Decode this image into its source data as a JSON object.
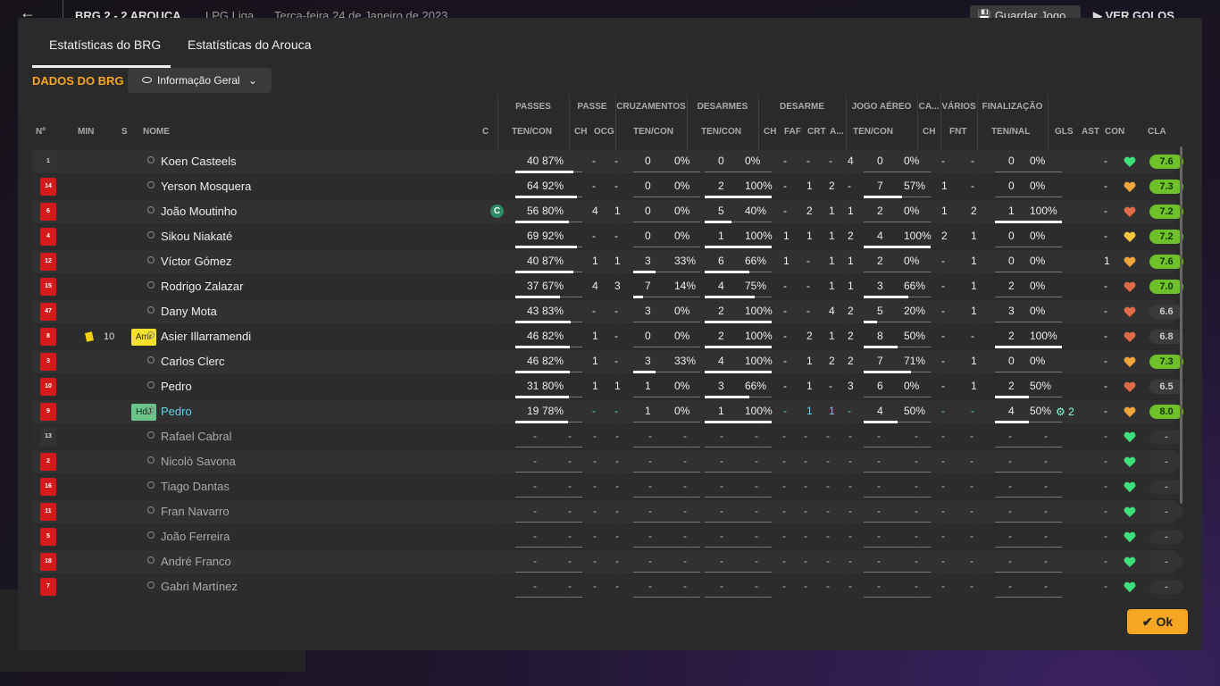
{
  "header": {
    "score": "BRG   2 - 2   AROUCA",
    "league": "LPG Liga",
    "date": "Terça-feira 24 de Janeiro de 2023",
    "save_label": "Guardar Jogo",
    "goals_label": "VER GOLOS"
  },
  "tabs": [
    {
      "label": "Estatísticas do BRG",
      "active": true
    },
    {
      "label": "Estatísticas do Arouca",
      "active": false
    }
  ],
  "section_title": "DADOS DO BRG",
  "view_select": {
    "value": "Informação Geral",
    "icon": "eye-icon"
  },
  "group_headers": [
    "PASSES",
    "PASSE",
    "CRUZAMENTOS",
    "DESARMES",
    "DESARME",
    "JOGO AÉREO",
    "CA...",
    "VÁRIOS",
    "FINALIZAÇÃO"
  ],
  "columns": {
    "n": "Nº",
    "min": "MIN",
    "s": "S",
    "nome": "NOME",
    "c": "C",
    "passes": "TEN/CON",
    "passe_ch": "CH",
    "passe_ocg": "OCG",
    "cruz": "TEN/CON",
    "desarmes": "TEN/CON",
    "des_ch": "CH",
    "des_faf": "FAF",
    "des_crt": "CRT",
    "des_a": "A...",
    "aereo": "TEN/CON",
    "ca_ch": "CH",
    "fnt": "FNT",
    "final": "TEN/NAL",
    "gls": "GLS",
    "ast": "AST",
    "con": "CON",
    "cla": "CLA"
  },
  "players": [
    {
      "num": "1",
      "gk": true,
      "name": "Koen Casteels",
      "status": "",
      "min": "",
      "pos": "",
      "pos_type": "",
      "captain": false,
      "yellow": false,
      "pass": [
        "40",
        "87%"
      ],
      "pass_pct": 0.87,
      "p_ch": "-",
      "p_ocg": "-",
      "cross": [
        "0",
        "0%"
      ],
      "cross_pct": 0,
      "tackles": [
        "0",
        "0%"
      ],
      "tack_pct": 0,
      "d_ch": "-",
      "d_faf": "-",
      "d_crt": "-",
      "d_a": "4",
      "air": [
        "0",
        "0%"
      ],
      "air_pct": 0,
      "ca_ch": "-",
      "fnt": "-",
      "fin": [
        "0",
        "0%"
      ],
      "fin_pct": 0,
      "gls": "",
      "ast": "-",
      "con": "green",
      "cla": "7.6",
      "cla_type": "hi"
    },
    {
      "num": "14",
      "gk": false,
      "name": "Yerson Mosquera",
      "status": "",
      "min": "",
      "pos": "",
      "pos_type": "",
      "captain": false,
      "yellow": false,
      "pass": [
        "64",
        "92%"
      ],
      "pass_pct": 0.92,
      "p_ch": "-",
      "p_ocg": "-",
      "cross": [
        "0",
        "0%"
      ],
      "cross_pct": 0,
      "tackles": [
        "2",
        "100%"
      ],
      "tack_pct": 1,
      "d_ch": "-",
      "d_faf": "1",
      "d_crt": "2",
      "d_a": "-",
      "air": [
        "7",
        "57%"
      ],
      "air_pct": 0.57,
      "ca_ch": "1",
      "fnt": "-",
      "fin": [
        "0",
        "0%"
      ],
      "fin_pct": 0,
      "gls": "",
      "ast": "-",
      "con": "orange",
      "cla": "7.3",
      "cla_type": "hi"
    },
    {
      "num": "6",
      "gk": false,
      "name": "João Moutinho",
      "status": "",
      "min": "",
      "pos": "",
      "pos_type": "",
      "captain": true,
      "yellow": false,
      "pass": [
        "56",
        "80%"
      ],
      "pass_pct": 0.8,
      "p_ch": "4",
      "p_ocg": "1",
      "cross": [
        "0",
        "0%"
      ],
      "cross_pct": 0,
      "tackles": [
        "5",
        "40%"
      ],
      "tack_pct": 0.4,
      "d_ch": "-",
      "d_faf": "2",
      "d_crt": "1",
      "d_a": "1",
      "air": [
        "2",
        "0%"
      ],
      "air_pct": 0,
      "ca_ch": "1",
      "fnt": "2",
      "fin": [
        "1",
        "100%"
      ],
      "fin_pct": 1,
      "gls": "",
      "ast": "-",
      "con": "red",
      "cla": "7.2",
      "cla_type": "hi"
    },
    {
      "num": "4",
      "gk": false,
      "name": "Sikou Niakaté",
      "status": "",
      "min": "",
      "pos": "",
      "pos_type": "",
      "captain": false,
      "yellow": false,
      "pass": [
        "69",
        "92%"
      ],
      "pass_pct": 0.92,
      "p_ch": "-",
      "p_ocg": "-",
      "cross": [
        "0",
        "0%"
      ],
      "cross_pct": 0,
      "tackles": [
        "1",
        "100%"
      ],
      "tack_pct": 1,
      "d_ch": "1",
      "d_faf": "1",
      "d_crt": "1",
      "d_a": "2",
      "air": [
        "4",
        "100%"
      ],
      "air_pct": 1,
      "ca_ch": "2",
      "fnt": "1",
      "fin": [
        "0",
        "0%"
      ],
      "fin_pct": 0,
      "gls": "",
      "ast": "-",
      "con": "yellow",
      "cla": "7.2",
      "cla_type": "hi"
    },
    {
      "num": "12",
      "gk": false,
      "name": "Víctor Gómez",
      "status": "",
      "min": "",
      "pos": "",
      "pos_type": "",
      "captain": false,
      "yellow": false,
      "pass": [
        "40",
        "87%"
      ],
      "pass_pct": 0.87,
      "p_ch": "1",
      "p_ocg": "1",
      "cross": [
        "3",
        "33%"
      ],
      "cross_pct": 0.33,
      "tackles": [
        "6",
        "66%"
      ],
      "tack_pct": 0.66,
      "d_ch": "1",
      "d_faf": "-",
      "d_crt": "1",
      "d_a": "1",
      "air": [
        "2",
        "0%"
      ],
      "air_pct": 0,
      "ca_ch": "-",
      "fnt": "1",
      "fin": [
        "0",
        "0%"
      ],
      "fin_pct": 0,
      "gls": "",
      "ast": "1",
      "con": "orange",
      "cla": "7.6",
      "cla_type": "hi"
    },
    {
      "num": "15",
      "gk": false,
      "name": "Rodrigo Zalazar",
      "status": "",
      "min": "",
      "pos": "",
      "pos_type": "",
      "captain": false,
      "yellow": false,
      "pass": [
        "37",
        "67%"
      ],
      "pass_pct": 0.67,
      "p_ch": "4",
      "p_ocg": "3",
      "cross": [
        "7",
        "14%"
      ],
      "cross_pct": 0.14,
      "tackles": [
        "4",
        "75%"
      ],
      "tack_pct": 0.75,
      "d_ch": "-",
      "d_faf": "-",
      "d_crt": "1",
      "d_a": "1",
      "air": [
        "3",
        "66%"
      ],
      "air_pct": 0.66,
      "ca_ch": "-",
      "fnt": "1",
      "fin": [
        "2",
        "0%"
      ],
      "fin_pct": 0,
      "gls": "",
      "ast": "-",
      "con": "red",
      "cla": "7.0",
      "cla_type": "hi"
    },
    {
      "num": "47",
      "gk": false,
      "name": "Dany Mota",
      "status": "",
      "min": "",
      "pos": "",
      "pos_type": "",
      "captain": false,
      "yellow": false,
      "pass": [
        "43",
        "83%"
      ],
      "pass_pct": 0.83,
      "p_ch": "-",
      "p_ocg": "-",
      "cross": [
        "3",
        "0%"
      ],
      "cross_pct": 0,
      "tackles": [
        "2",
        "100%"
      ],
      "tack_pct": 1,
      "d_ch": "-",
      "d_faf": "-",
      "d_crt": "4",
      "d_a": "2",
      "air": [
        "5",
        "20%"
      ],
      "air_pct": 0.2,
      "ca_ch": "-",
      "fnt": "1",
      "fin": [
        "3",
        "0%"
      ],
      "fin_pct": 0,
      "gls": "",
      "ast": "-",
      "con": "red",
      "cla": "6.6",
      "cla_type": "gr"
    },
    {
      "num": "8",
      "gk": false,
      "name": "Asier Illarramendi",
      "status": "",
      "min": "10",
      "pos": "Amr",
      "pos_type": "amr",
      "captain": false,
      "yellow": true,
      "pass": [
        "46",
        "82%"
      ],
      "pass_pct": 0.82,
      "p_ch": "1",
      "p_ocg": "-",
      "cross": [
        "0",
        "0%"
      ],
      "cross_pct": 0,
      "tackles": [
        "2",
        "100%"
      ],
      "tack_pct": 1,
      "d_ch": "-",
      "d_faf": "2",
      "d_crt": "1",
      "d_a": "2",
      "air": [
        "8",
        "50%"
      ],
      "air_pct": 0.5,
      "ca_ch": "-",
      "fnt": "-",
      "fin": [
        "2",
        "100%"
      ],
      "fin_pct": 1,
      "gls": "",
      "ast": "-",
      "con": "red",
      "cla": "6.8",
      "cla_type": "gr"
    },
    {
      "num": "3",
      "gk": false,
      "name": "Carlos Clerc",
      "status": "",
      "min": "",
      "pos": "",
      "pos_type": "",
      "captain": false,
      "yellow": false,
      "pass": [
        "46",
        "82%"
      ],
      "pass_pct": 0.82,
      "p_ch": "1",
      "p_ocg": "-",
      "cross": [
        "3",
        "33%"
      ],
      "cross_pct": 0.33,
      "tackles": [
        "4",
        "100%"
      ],
      "tack_pct": 1,
      "d_ch": "-",
      "d_faf": "1",
      "d_crt": "2",
      "d_a": "2",
      "air": [
        "7",
        "71%"
      ],
      "air_pct": 0.71,
      "ca_ch": "-",
      "fnt": "1",
      "fin": [
        "0",
        "0%"
      ],
      "fin_pct": 0,
      "gls": "",
      "ast": "-",
      "con": "orange",
      "cla": "7.3",
      "cla_type": "hi"
    },
    {
      "num": "10",
      "gk": false,
      "name": "Pedro",
      "status": "",
      "min": "",
      "pos": "",
      "pos_type": "",
      "captain": false,
      "yellow": false,
      "pass": [
        "31",
        "80%"
      ],
      "pass_pct": 0.8,
      "p_ch": "1",
      "p_ocg": "1",
      "cross": [
        "1",
        "0%"
      ],
      "cross_pct": 0,
      "tackles": [
        "3",
        "66%"
      ],
      "tack_pct": 0.66,
      "d_ch": "-",
      "d_faf": "1",
      "d_crt": "-",
      "d_a": "3",
      "air": [
        "6",
        "0%"
      ],
      "air_pct": 0,
      "ca_ch": "-",
      "fnt": "1",
      "fin": [
        "2",
        "50%"
      ],
      "fin_pct": 0.5,
      "gls": "",
      "ast": "-",
      "con": "red",
      "cla": "6.5",
      "cla_type": "gr"
    },
    {
      "num": "9",
      "gk": false,
      "name": "Pedro",
      "status": "hl",
      "min": "",
      "pos": "HdJ",
      "pos_type": "hdj",
      "captain": false,
      "yellow": false,
      "pass": [
        "19",
        "78%"
      ],
      "pass_pct": 0.78,
      "p_ch": "-",
      "p_ocg": "-",
      "cross": [
        "1",
        "0%"
      ],
      "cross_pct": 0,
      "tackles": [
        "1",
        "100%"
      ],
      "tack_pct": 1,
      "d_ch": "-",
      "d_faf": "1",
      "d_crt": "1",
      "d_a": "-",
      "air": [
        "4",
        "50%"
      ],
      "air_pct": 0.5,
      "ca_ch": "-",
      "fnt": "-",
      "fin": [
        "4",
        "50%"
      ],
      "fin_pct": 0.5,
      "gls": "2",
      "ast": "-",
      "con": "orange",
      "cla": "8.0",
      "cla_type": "hi"
    },
    {
      "num": "13",
      "gk": true,
      "name": "Rafael Cabral",
      "status": "sub",
      "empty": true,
      "con": "green",
      "cla": "-"
    },
    {
      "num": "2",
      "gk": false,
      "name": "Nicolò Savona",
      "status": "sub",
      "empty": true,
      "con": "green",
      "cla": "-"
    },
    {
      "num": "16",
      "gk": false,
      "name": "Tiago Dantas",
      "status": "sub",
      "empty": true,
      "con": "green",
      "cla": "-"
    },
    {
      "num": "11",
      "gk": false,
      "name": "Fran Navarro",
      "status": "sub",
      "empty": true,
      "con": "green",
      "cla": "-"
    },
    {
      "num": "5",
      "gk": false,
      "name": "João Ferreira",
      "status": "sub",
      "empty": true,
      "con": "green",
      "cla": "-"
    },
    {
      "num": "18",
      "gk": false,
      "name": "André Franco",
      "status": "sub",
      "empty": true,
      "con": "green",
      "cla": "-"
    },
    {
      "num": "7",
      "gk": false,
      "name": "Gabri Martínez",
      "status": "sub",
      "empty": true,
      "con": "green",
      "cla": "-"
    }
  ],
  "captain_badge": "C",
  "ok_label": "Ok",
  "colors": {
    "accent": "#f5a623",
    "rating_high": "#6ec12a",
    "highlight": "#5fd3e8",
    "con_green": "#3ee07a",
    "con_orange": "#f0a53c",
    "con_red": "#e06a4a",
    "con_yellow": "#f2c53a"
  }
}
